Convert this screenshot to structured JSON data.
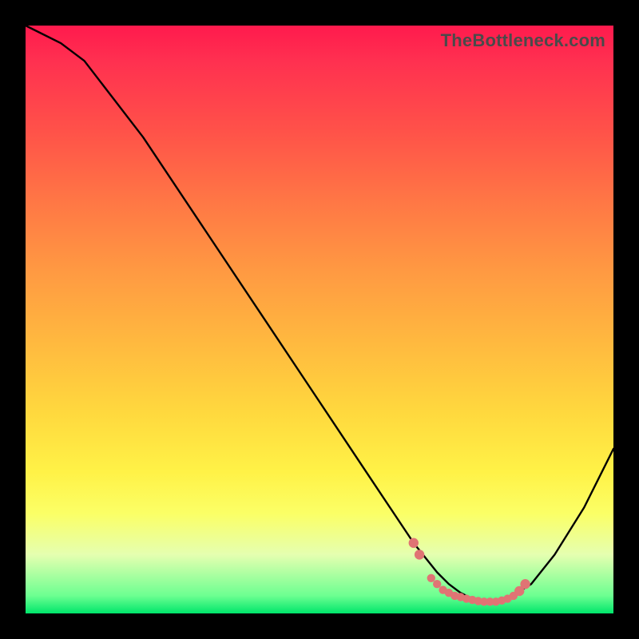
{
  "watermark": "TheBottleneck.com",
  "colors": {
    "background": "#000000",
    "curve": "#000000",
    "dots": "#e07474"
  },
  "chart_data": {
    "type": "line",
    "title": "",
    "xlabel": "",
    "ylabel": "",
    "xlim": [
      0,
      100
    ],
    "ylim": [
      0,
      100
    ],
    "grid": false,
    "series": [
      {
        "name": "curve",
        "x": [
          0,
          6,
          10,
          20,
          30,
          40,
          50,
          58,
          62,
          66,
          70,
          72,
          74,
          76,
          78,
          80,
          82,
          86,
          90,
          95,
          100
        ],
        "values": [
          100,
          97,
          94,
          81,
          66,
          51,
          36,
          24,
          18,
          12,
          7,
          5,
          3.5,
          2.5,
          2,
          2,
          2.5,
          5,
          10,
          18,
          28
        ]
      }
    ],
    "markers": [
      {
        "x": 66,
        "y": 12,
        "r": 1.2
      },
      {
        "x": 67,
        "y": 10,
        "r": 1.2
      },
      {
        "x": 69,
        "y": 6,
        "r": 1.0
      },
      {
        "x": 70,
        "y": 5,
        "r": 1.0
      },
      {
        "x": 71,
        "y": 4,
        "r": 1.0
      },
      {
        "x": 72,
        "y": 3.5,
        "r": 1.0
      },
      {
        "x": 73,
        "y": 3,
        "r": 1.0
      },
      {
        "x": 74,
        "y": 2.8,
        "r": 1.0
      },
      {
        "x": 75,
        "y": 2.5,
        "r": 1.0
      },
      {
        "x": 76,
        "y": 2.3,
        "r": 1.0
      },
      {
        "x": 77,
        "y": 2.1,
        "r": 1.0
      },
      {
        "x": 78,
        "y": 2,
        "r": 1.0
      },
      {
        "x": 79,
        "y": 2,
        "r": 1.0
      },
      {
        "x": 80,
        "y": 2,
        "r": 1.0
      },
      {
        "x": 81,
        "y": 2.2,
        "r": 1.0
      },
      {
        "x": 82,
        "y": 2.5,
        "r": 1.0
      },
      {
        "x": 83,
        "y": 3,
        "r": 1.0
      },
      {
        "x": 84,
        "y": 3.8,
        "r": 1.2
      },
      {
        "x": 85,
        "y": 5,
        "r": 1.2
      }
    ]
  }
}
